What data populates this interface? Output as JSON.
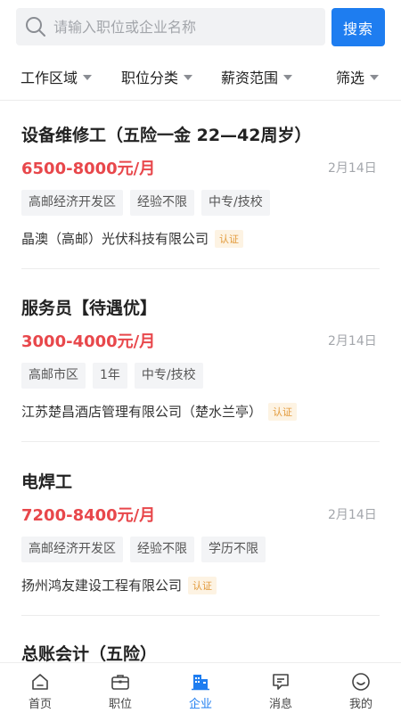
{
  "search": {
    "placeholder": "请输入职位或企业名称",
    "button_label": "搜索"
  },
  "filters": [
    {
      "label": "工作区域"
    },
    {
      "label": "职位分类"
    },
    {
      "label": "薪资范围"
    },
    {
      "label": "筛选"
    }
  ],
  "jobs": [
    {
      "title": "设备维修工（五险一金 22—42周岁）",
      "salary": "6500-8000元/月",
      "date": "2月14日",
      "tags": [
        "高邮经济开发区",
        "经验不限",
        "中专/技校"
      ],
      "company": "晶澳（高邮）光伏科技有限公司",
      "badge": "认证"
    },
    {
      "title": "服务员【待遇优】",
      "salary": "3000-4000元/月",
      "date": "2月14日",
      "tags": [
        "高邮市区",
        "1年",
        "中专/技校"
      ],
      "company": "江苏楚昌酒店管理有限公司（楚水兰亭）",
      "badge": "认证"
    },
    {
      "title": "电焊工",
      "salary": "7200-8400元/月",
      "date": "2月14日",
      "tags": [
        "高邮经济开发区",
        "经验不限",
        "学历不限"
      ],
      "company": "扬州鸿友建设工程有限公司",
      "badge": "认证"
    },
    {
      "title": "总账会计（五险）"
    }
  ],
  "nav": [
    {
      "label": "首页",
      "icon": "home-icon"
    },
    {
      "label": "职位",
      "icon": "briefcase-icon"
    },
    {
      "label": "企业",
      "icon": "building-icon",
      "active": true
    },
    {
      "label": "消息",
      "icon": "message-icon"
    },
    {
      "label": "我的",
      "icon": "profile-icon"
    }
  ],
  "colors": {
    "accent": "#1e7df0",
    "salary": "#e8474b",
    "badge_text": "#e29a3b",
    "badge_bg": "#fdf3e3"
  }
}
